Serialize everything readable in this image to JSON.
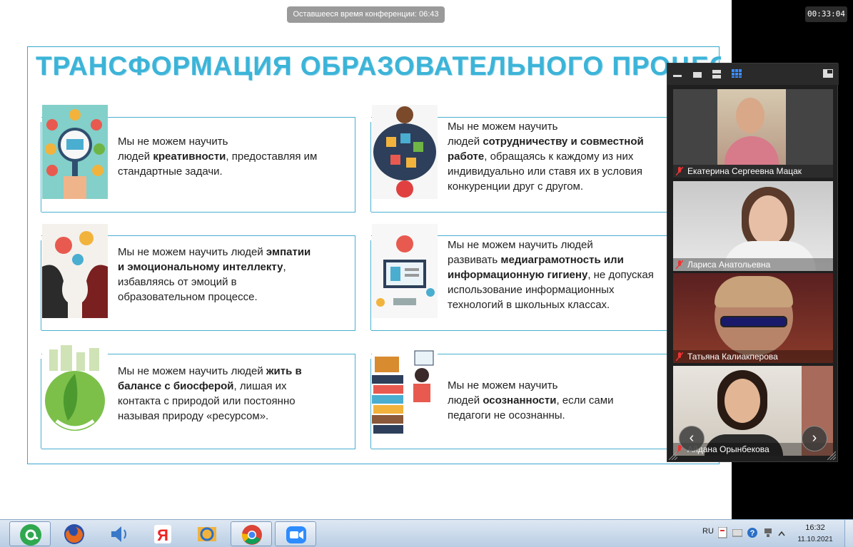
{
  "conference": {
    "remaining_time_text": "Оставшееся время конференции: 06:43",
    "clock": "00:33:04"
  },
  "slide": {
    "title": "ТРАНСФОРМАЦИЯ ОБРАЗОВАТЕЛЬНОГО ПРОЦЕССА",
    "cards": [
      {
        "lines": [
          "Мы не можем научить",
          "людей |креативности|, предоставляя им",
          "стандартные задачи."
        ]
      },
      {
        "lines": [
          "Мы не можем научить",
          "людей |сотрудничеству и совместной|",
          "|работе|, обращаясь к каждому из них",
          "индивидуально или ставя их в условия",
          "конкуренции друг с другом."
        ]
      },
      {
        "lines": [
          "Мы не можем научить людей |эмпатии|",
          "|и эмоциональному интеллекту|,",
          "избавляясь от эмоций в",
          "образовательном процессе."
        ]
      },
      {
        "lines": [
          "Мы не можем научить людей",
          "развивать |медиаграмотность или|",
          "|информационную гигиену|, не допуская",
          "использование информационных",
          "технологий в школьных классах."
        ]
      },
      {
        "lines": [
          "Мы не можем научить людей |жить в|",
          "|балансе с биосферой|, лишая их",
          "контакта с природой или постоянно",
          "называя природу «ресурсом»."
        ]
      },
      {
        "lines": [
          "Мы не можем научить",
          "людей |осознанности|,  если сами",
          "педагоги не осознанны."
        ]
      }
    ]
  },
  "participants": [
    {
      "name": "Екатерина Сергеевна Мацак"
    },
    {
      "name": "Лариса Анатольевна"
    },
    {
      "name": "Татьяна Калиакперова"
    },
    {
      "name": "Айдана Орынбекова"
    }
  ],
  "taskbar": {
    "apps": [
      "mail-agent-icon",
      "firefox-icon",
      "volume-app-icon",
      "yandex-icon",
      "mail-client-icon",
      "chrome-icon",
      "zoom-icon"
    ],
    "lang": "RU",
    "time": "16:32",
    "date": "11.10.2021"
  },
  "colors": {
    "title": "#3cb4d8",
    "frame": "#3aa8c9",
    "taskbar": "#c9d8ea"
  }
}
